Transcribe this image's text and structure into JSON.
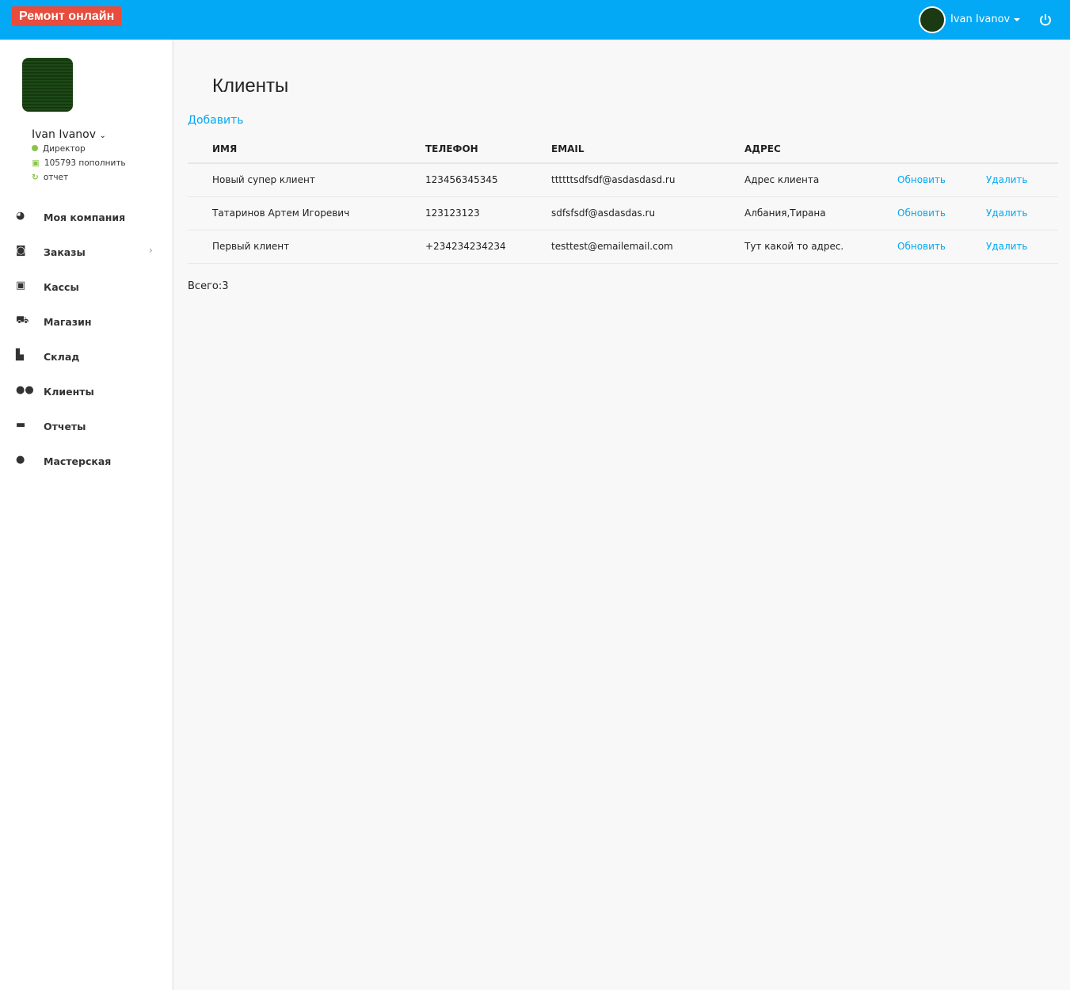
{
  "header": {
    "brand": "Ремонт онлайн",
    "user": "Ivan Ivanov"
  },
  "profile": {
    "name": "Ivan Ivanov",
    "role": "Директор",
    "balance": "105793 пополнить",
    "report": "отчет"
  },
  "nav": [
    {
      "label": "Моя компания",
      "icon": "dashboard-icon"
    },
    {
      "label": "Заказы",
      "icon": "orders-icon"
    },
    {
      "label": "Кассы",
      "icon": "money-icon"
    },
    {
      "label": "Магазин",
      "icon": "cart-icon"
    },
    {
      "label": "Склад",
      "icon": "files-icon"
    },
    {
      "label": "Клиенты",
      "icon": "users-icon"
    },
    {
      "label": "Отчеты",
      "icon": "briefcase-icon"
    },
    {
      "label": "Мастерская",
      "icon": "circle-icon"
    }
  ],
  "page": {
    "title": "Клиенты",
    "add": "Добавить",
    "total": "Всего:3"
  },
  "table": {
    "headers": [
      "ИМЯ",
      "ТЕЛЕФОН",
      "EMAIL",
      "АДРЕС"
    ],
    "rows": [
      {
        "name": "Новый супер клиент",
        "phone": "123456345345",
        "email": "ttttttsdfsdf@asdasdasd.ru",
        "address": "Адрес клиента",
        "update": "Обновить",
        "delete": "Удалить"
      },
      {
        "name": "Татаринов Артем Игоревич",
        "phone": "123123123",
        "email": "sdfsfsdf@asdasdas.ru",
        "address": "Албания,Тирана",
        "update": "Обновить",
        "delete": "Удалить"
      },
      {
        "name": "Первый клиент",
        "phone": "+234234234234",
        "email": "testtest@emailemail.com",
        "address": "Тут какой то адрес.",
        "update": "Обновить",
        "delete": "Удалить"
      }
    ]
  }
}
